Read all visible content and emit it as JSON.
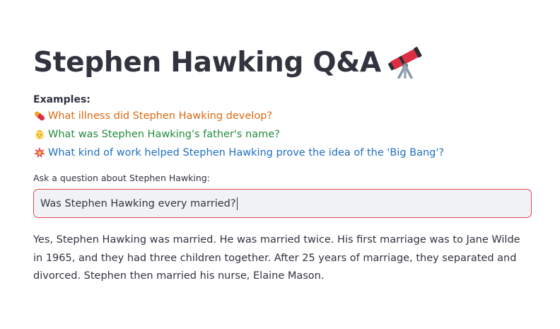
{
  "header": {
    "title": "Stephen Hawking Q&A",
    "title_icon": "telescope-icon"
  },
  "examples": {
    "label": "Examples:",
    "items": [
      {
        "icon": "pill-icon",
        "text": "What illness did Stephen Hawking develop?",
        "color": "#d86a14"
      },
      {
        "icon": "baby-face-icon",
        "text": "What was Stephen Hawking's father's name?",
        "color": "#248a3d"
      },
      {
        "icon": "collision-icon",
        "text": "What kind of work helped Stephen Hawking prove the idea of the 'Big Bang'?",
        "color": "#1f6fc1"
      }
    ]
  },
  "question": {
    "label": "Ask a question about Stephen Hawking:",
    "value": "Was Stephen Hawking every married?",
    "border_color": "#e5484d"
  },
  "answer": {
    "text": "Yes, Stephen Hawking was married. He was married twice. His first marriage was to Jane Wilde in 1965, and they had three children together. After 25 years of marriage, they separated and divorced. Stephen then married his nurse, Elaine Mason."
  }
}
